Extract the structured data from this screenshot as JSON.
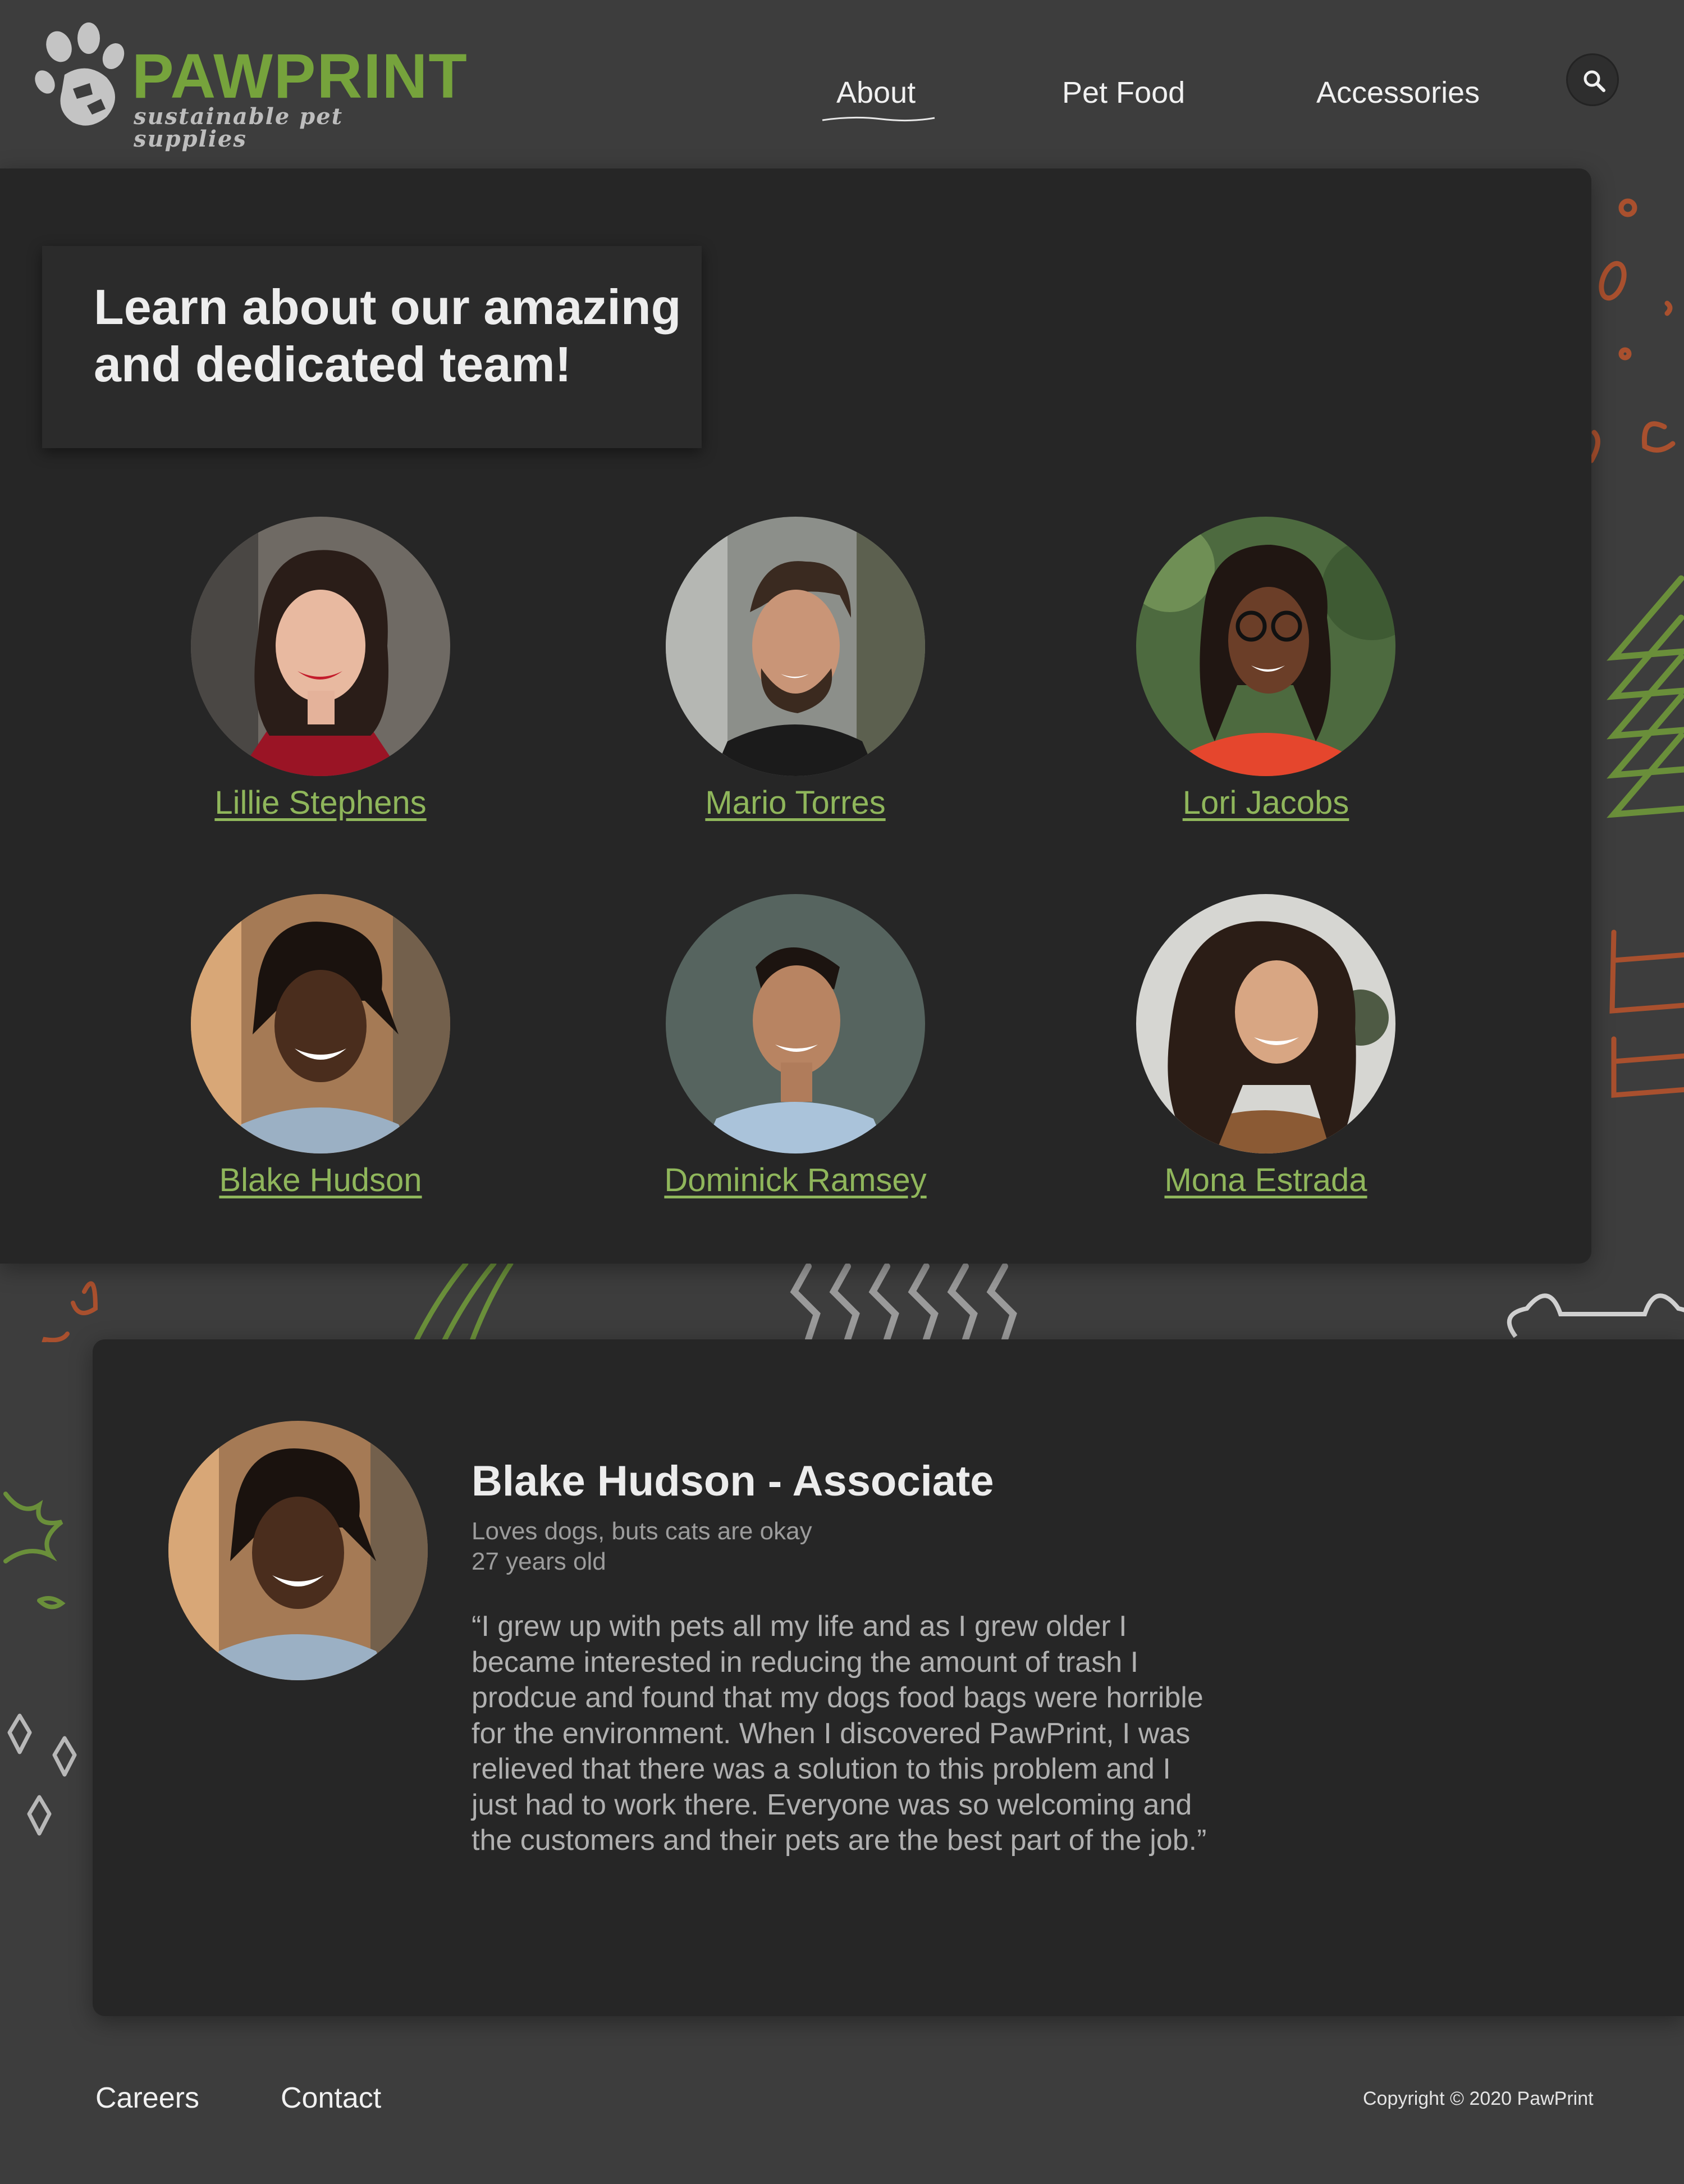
{
  "brand": {
    "name": "PAWPRINT",
    "tagline": "sustainable pet supplies",
    "accent_color": "#76a33c",
    "link_color": "#8fb65b"
  },
  "nav": {
    "items": [
      {
        "label": "About",
        "active": true
      },
      {
        "label": "Pet Food"
      },
      {
        "label": "Accessories"
      }
    ],
    "search_icon": "search-icon"
  },
  "team": {
    "heading": "Learn about our amazing and dedicated team!",
    "members": [
      {
        "name": "Lillie Stephens"
      },
      {
        "name": "Mario Torres"
      },
      {
        "name": "Lori Jacobs"
      },
      {
        "name": "Blake Hudson"
      },
      {
        "name": "Dominick Ramsey"
      },
      {
        "name": "Mona Estrada"
      }
    ]
  },
  "profile": {
    "title": "Blake Hudson - Associate",
    "likes": "Loves dogs, buts cats are okay",
    "age": "27 years old",
    "quote": "“I grew up with pets all my life and as I grew older I became interested in reducing the amount of trash I prodcue and found that my dogs food bags were horrible for the environment. When I discovered PawPrint, I was relieved that there was a solution to this problem and I just had to work there. Everyone was so welcoming and the customers and their pets are the best part of the job.”"
  },
  "footer": {
    "careers": "Careers",
    "contact": "Contact",
    "copyright": "Copyright © 2020 PawPrint"
  }
}
